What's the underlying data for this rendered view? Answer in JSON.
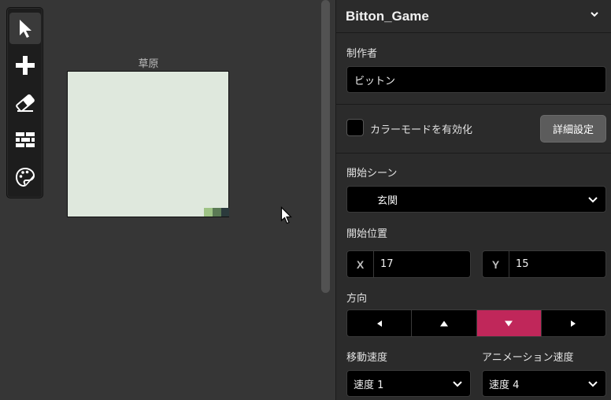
{
  "toolbar": {
    "tools": [
      {
        "name": "select-tool",
        "icon": "arrow-pointer-icon",
        "active": true
      },
      {
        "name": "add-tool",
        "icon": "plus-icon",
        "active": false
      },
      {
        "name": "eraser-tool",
        "icon": "eraser-icon",
        "active": false
      },
      {
        "name": "wall-tool",
        "icon": "brick-wall-icon",
        "active": false
      },
      {
        "name": "paint-tool",
        "icon": "palette-icon",
        "active": false
      }
    ]
  },
  "map": {
    "title": "草原",
    "background_color": "#dfe8dd",
    "corner_tiles": [
      "#9ec385",
      "#5b7a55",
      "#2b3a3c"
    ]
  },
  "panel": {
    "game_title": "Bitton_Game",
    "author_label": "制作者",
    "author_value": "ビットン",
    "color_mode_label": "カラーモードを有効化",
    "color_mode_checked": false,
    "advanced_button": "詳細設定",
    "start_scene_label": "開始シーン",
    "start_scene_value": "玄関",
    "start_position_label": "開始位置",
    "x_label": "X",
    "x_value": "17",
    "y_label": "Y",
    "y_value": "15",
    "direction_label": "方向",
    "directions": [
      "◀",
      "▲",
      "▼",
      "▶"
    ],
    "direction_selected": "▼",
    "move_speed_label": "移動速度",
    "move_speed_value": "速度 1",
    "anim_speed_label": "アニメーション速度",
    "anim_speed_value": "速度 4",
    "accent_color": "#c0275a"
  }
}
